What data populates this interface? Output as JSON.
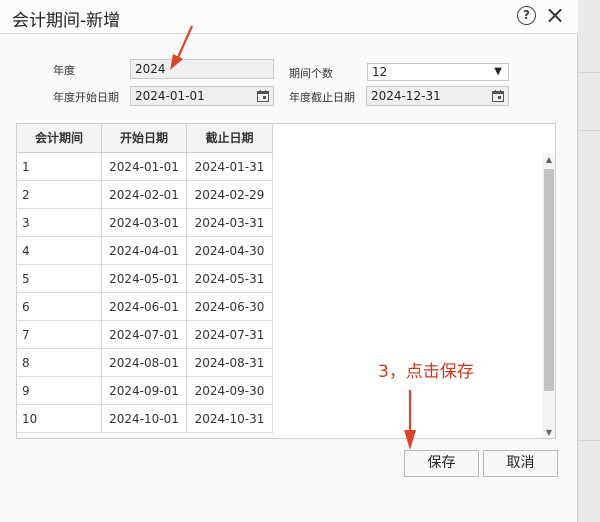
{
  "dialog": {
    "title": "会计期间-新增",
    "help_icon": "question-circle-icon",
    "close_icon": "close-icon"
  },
  "form": {
    "year_label": "年度",
    "year_value": "2024",
    "period_count_label": "期间个数",
    "period_count_value": "12",
    "start_date_label": "年度开始日期",
    "start_date_value": "2024-01-01",
    "end_date_label": "年度截止日期",
    "end_date_value": "2024-12-31",
    "calendar_icon": "calendar-icon"
  },
  "table": {
    "headers": [
      "会计期间",
      "开始日期",
      "截止日期"
    ],
    "rows": [
      [
        "1",
        "2024-01-01",
        "2024-01-31"
      ],
      [
        "2",
        "2024-02-01",
        "2024-02-29"
      ],
      [
        "3",
        "2024-03-01",
        "2024-03-31"
      ],
      [
        "4",
        "2024-04-01",
        "2024-04-30"
      ],
      [
        "5",
        "2024-05-01",
        "2024-05-31"
      ],
      [
        "6",
        "2024-06-01",
        "2024-06-30"
      ],
      [
        "7",
        "2024-07-01",
        "2024-07-31"
      ],
      [
        "8",
        "2024-08-01",
        "2024-08-31"
      ],
      [
        "9",
        "2024-09-01",
        "2024-09-30"
      ],
      [
        "10",
        "2024-10-01",
        "2024-10-31"
      ]
    ]
  },
  "buttons": {
    "save": "保存",
    "cancel": "取消"
  },
  "annotation": {
    "text": "3，点击保存",
    "color": "#c9391d"
  }
}
